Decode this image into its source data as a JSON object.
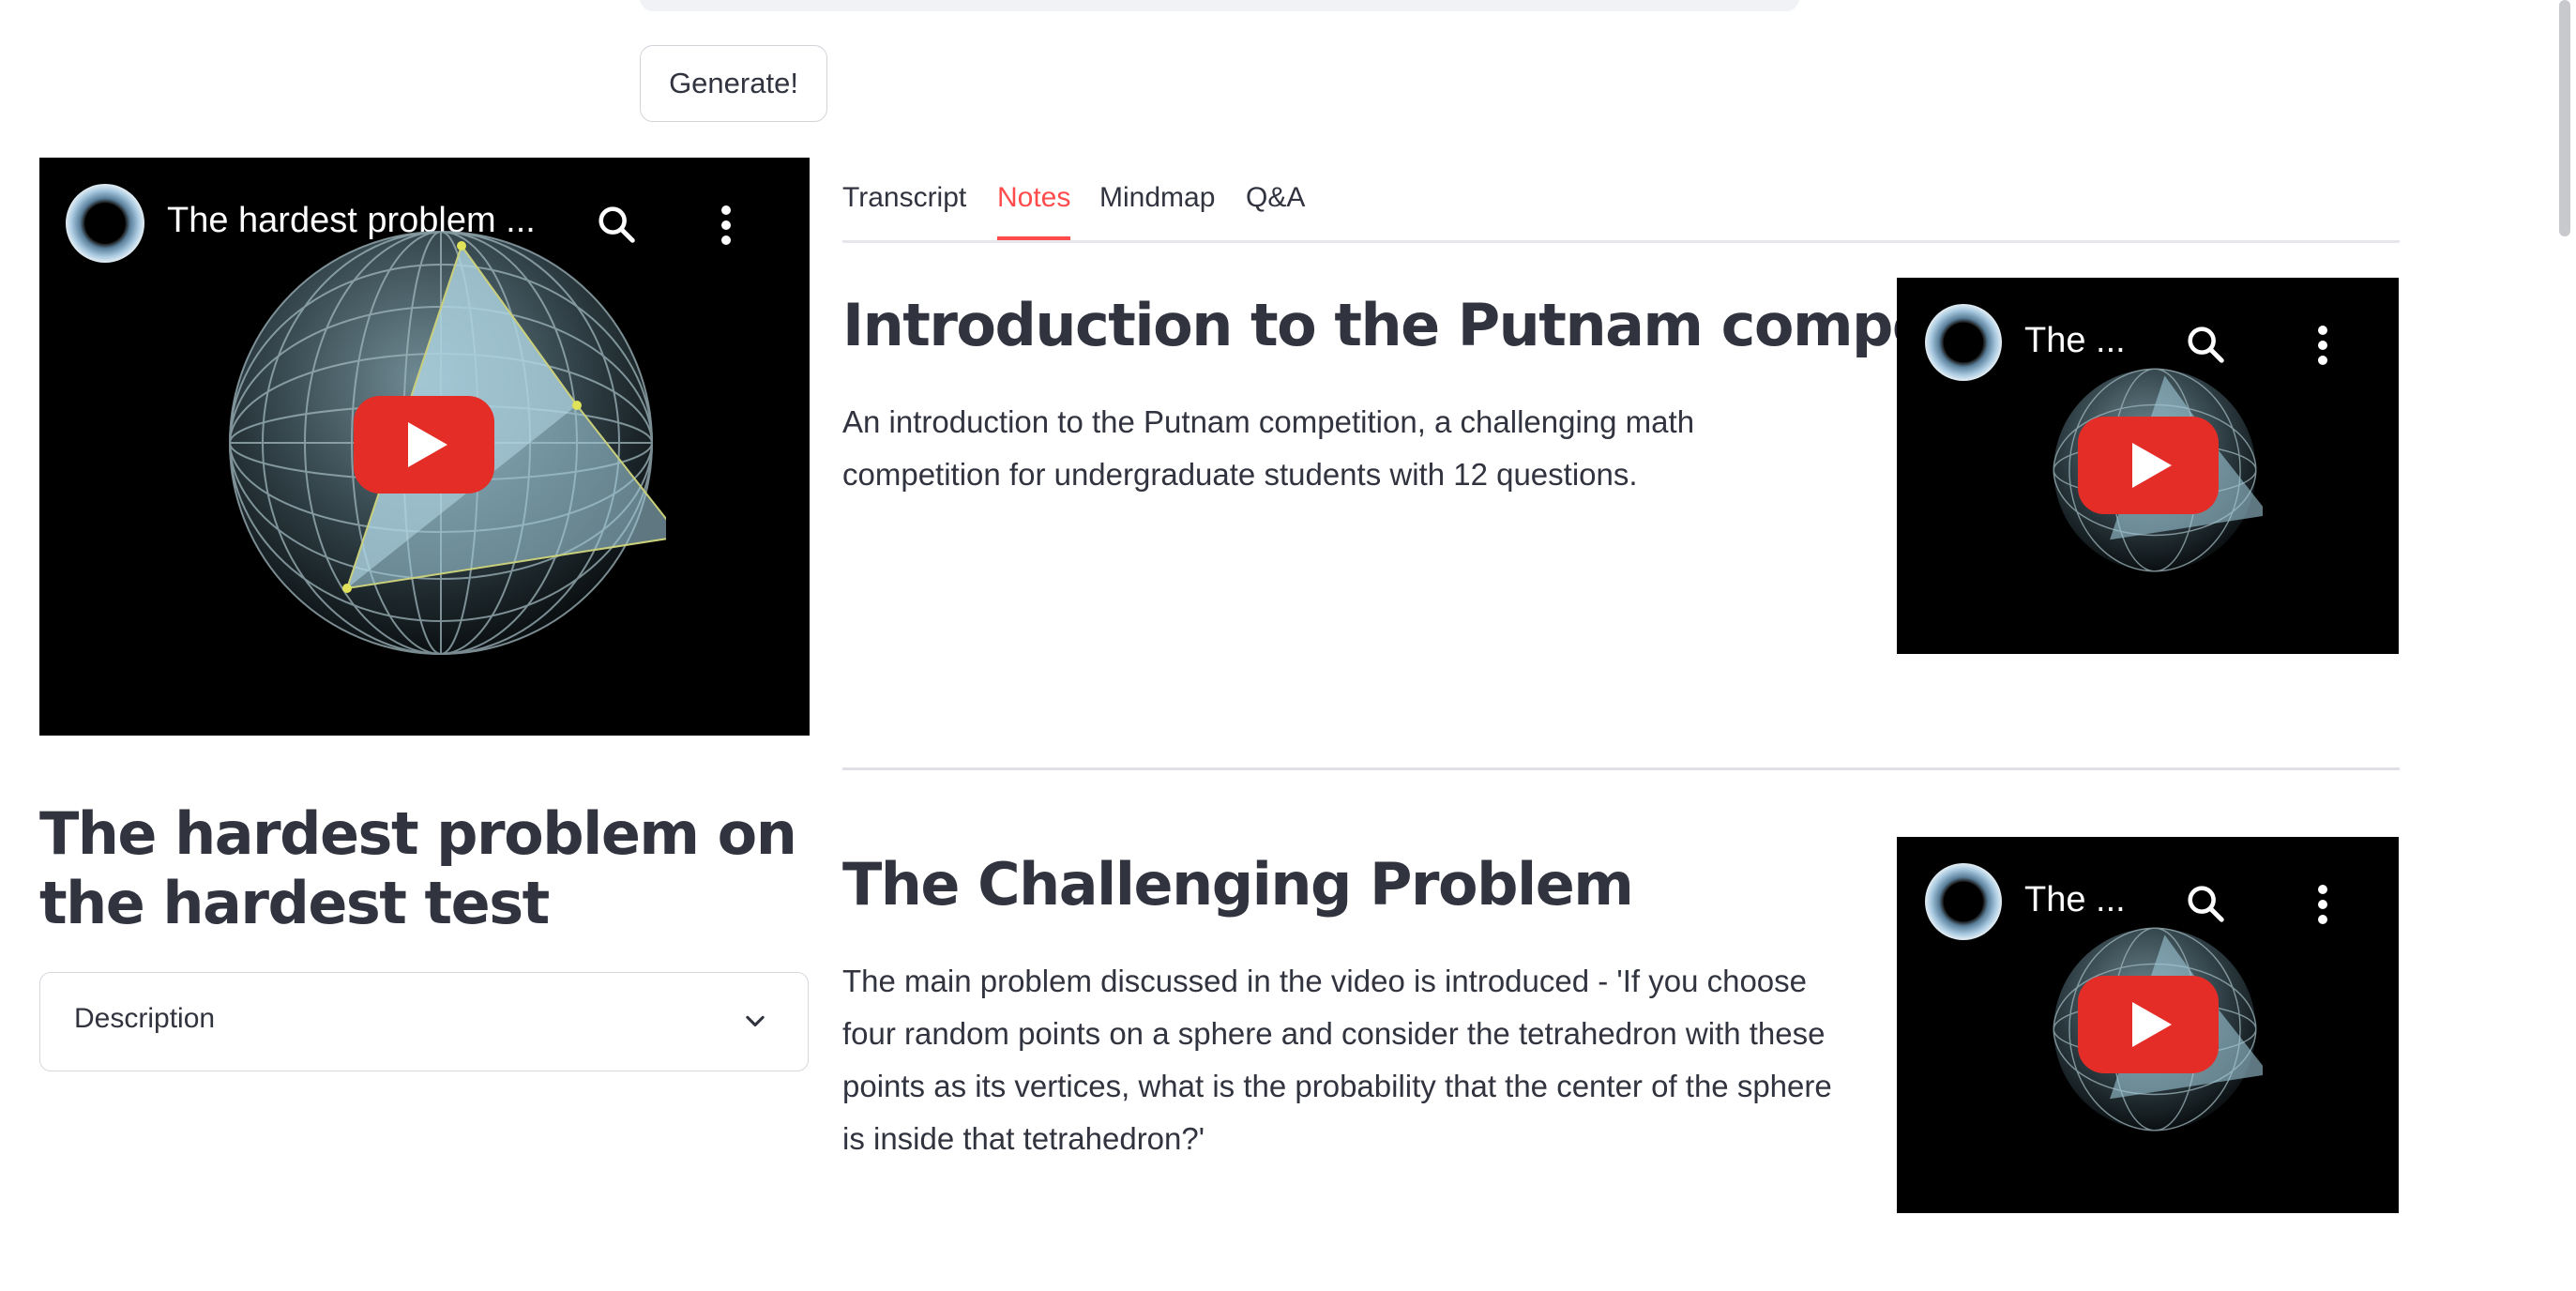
{
  "generate_button": {
    "label": "Generate!"
  },
  "main_video": {
    "title": "The hardest problem ...",
    "icons": [
      "channel-avatar",
      "search-icon",
      "more-vert-icon",
      "play-icon"
    ]
  },
  "tabs": [
    {
      "label": "Transcript",
      "active": false
    },
    {
      "label": "Notes",
      "active": true
    },
    {
      "label": "Mindmap",
      "active": false
    },
    {
      "label": "Q&A",
      "active": false
    }
  ],
  "sections": [
    {
      "heading": "Introduction to the Putnam competition",
      "lines": [
        "An introduction to the Putnam competition, a challenging math",
        "competition for undergraduate students with 12 questions."
      ],
      "video_title": "The ..."
    },
    {
      "heading": "The Challenging Problem",
      "lines": [
        "The main problem discussed in the video is introduced - 'If you choose",
        "four random points on a sphere and consider the tetrahedron with these",
        "points as its vertices, what is the probability that the center of the sphere",
        "is inside that tetrahedron?'"
      ],
      "video_title": "The ..."
    }
  ],
  "page_title": "The hardest problem on the hardest test",
  "expander": {
    "label": "Description",
    "icon": "chevron-down-icon"
  },
  "colors": {
    "accent": "#ff4b4b",
    "text": "#31333f",
    "youtube_red": "#e52d27"
  }
}
